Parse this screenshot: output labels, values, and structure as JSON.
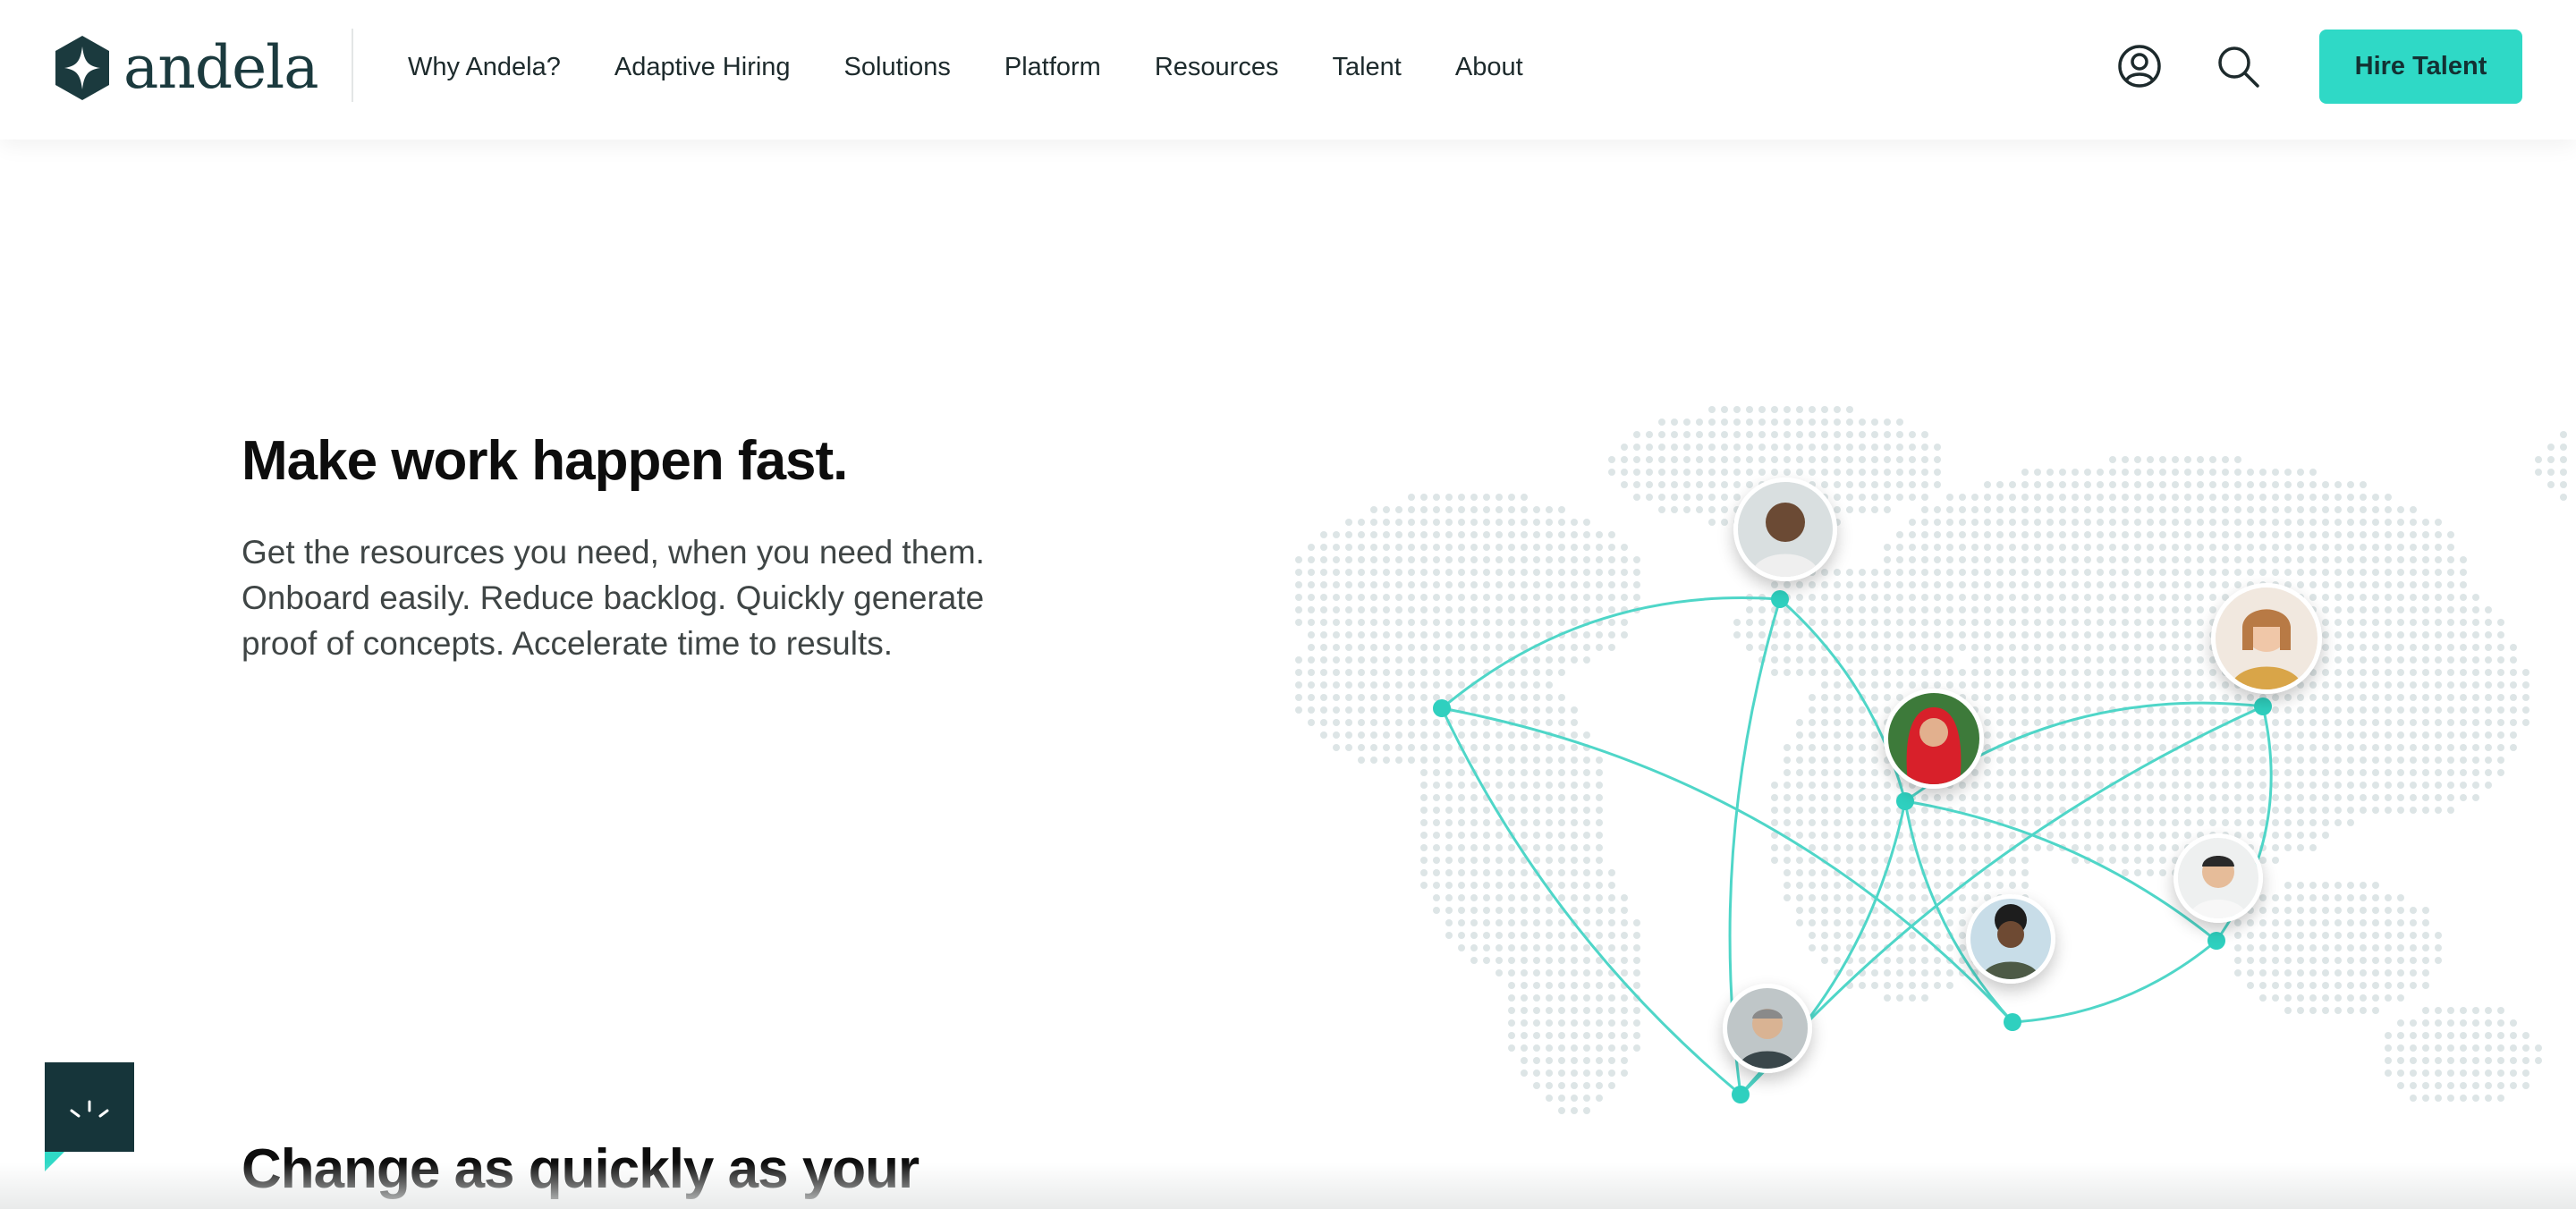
{
  "brand": {
    "name": "andela",
    "mark_color": "#1b3a3e",
    "accent_color": "#2fd9c6"
  },
  "nav": {
    "items": [
      {
        "label": "Why Andela?"
      },
      {
        "label": "Adaptive Hiring"
      },
      {
        "label": "Solutions"
      },
      {
        "label": "Platform"
      },
      {
        "label": "Resources"
      },
      {
        "label": "Talent"
      },
      {
        "label": "About"
      }
    ]
  },
  "header_actions": {
    "account_icon": "user-circle-icon",
    "search_icon": "search-icon",
    "cta_label": "Hire Talent"
  },
  "hero": {
    "title": "Make work happen fast.",
    "description": "Get the resources you need, when you need them. Onboard easily. Reduce backlog. Quickly generate proof of concepts. Accelerate time to results."
  },
  "next_section": {
    "title": "Change as quickly as your"
  },
  "chat_widget": {
    "icon": "chat-spark-icon"
  }
}
